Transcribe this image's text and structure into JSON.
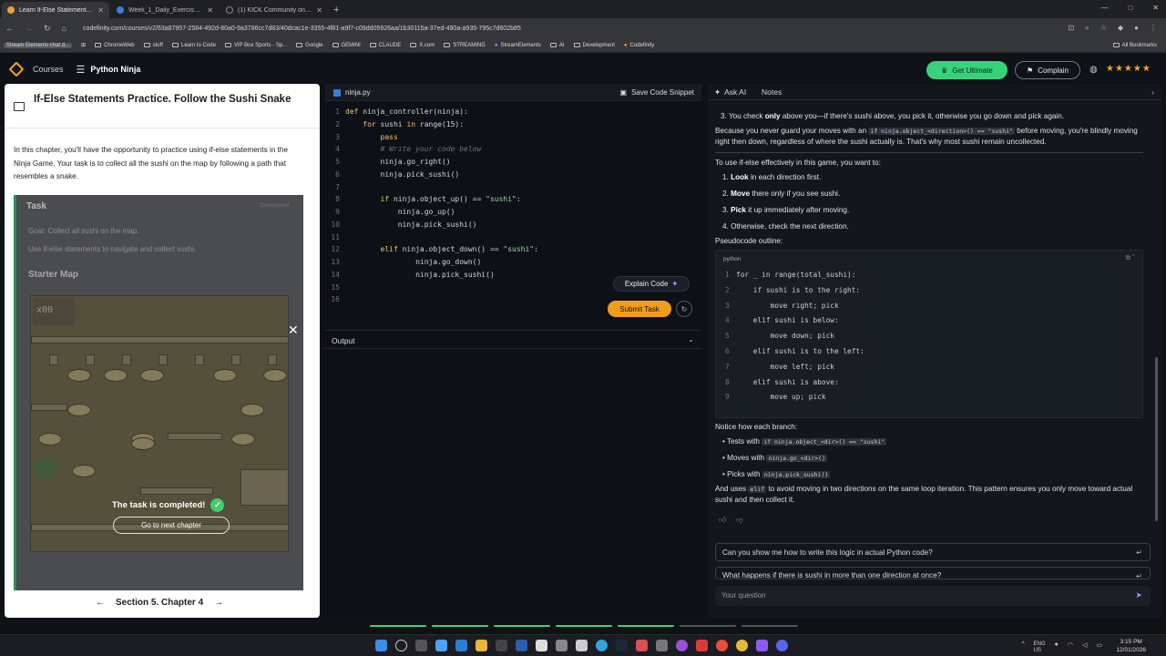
{
  "browser": {
    "tabs": [
      {
        "title": "Learn If-Else Statements Practic...",
        "active": true
      },
      {
        "title": "Week_1_Daily_Exercise_Guide.d",
        "active": false
      },
      {
        "title": "(1) KICK Community on X: \"@p",
        "active": false
      }
    ],
    "url": "codefinity.com/courses/v2/63a87957-2584-492d-80a0-9a3786cc7d83/40dcac1e-3355-4f81-a9f7-c09dd05926aa/1b30115a-37ed-490a-a935-795c7d602b85",
    "bookmarks": [
      "Stream Elements chat d...",
      "ChromeWeb",
      "stuff",
      "Learn to Code",
      "VIP Box Sports - Sp...",
      "Google",
      "GEMINI",
      "CLAUDE",
      "X.com",
      "STREAMING",
      "StreamElements",
      "AI",
      "Development",
      "Codefinity"
    ],
    "all_bookmarks": "All Bookmarks"
  },
  "header": {
    "courses": "Courses",
    "course_name": "Python Ninja",
    "get_ultimate": "Get Ultimate",
    "complain": "Complain",
    "stars": "★★★★★"
  },
  "lesson": {
    "title": "If-Else Statements Practice. Follow the Sushi Snake",
    "intro": "In this chapter, you'll have the opportunity to practice using if-else statements in the Ninja Game. Your task is to collect all the sushi on the map by following a path that resembles a snake.",
    "task_title": "Task",
    "completed_label": "Completed",
    "goal": "Goal: Collect all sushi on the map.",
    "goal_hint": "Use if-else statements to navigate and collect sushi.",
    "starter_map": "Starter Map",
    "score": "x00",
    "done_text": "The task is completed!",
    "next_button": "Go to next chapter",
    "section_nav": "Section 5. Chapter 4"
  },
  "editor": {
    "filename": "ninja.py",
    "save_snippet": "Save Code Snippet",
    "explain": "Explain Code",
    "submit": "Submit Task",
    "output": "Output",
    "lines": [
      "def ninja_controller(ninja):",
      "    for sushi in range(15):",
      "        pass",
      "        # Write your code below",
      "        ninja.go_right()",
      "        ninja.pick_sushi()",
      "",
      "        if ninja.object_up() == \"sushi\":",
      "            ninja.go_up()",
      "            ninja.pick_sushi()",
      "",
      "        elif ninja.object_down() == \"sushi\":",
      "                ninja.go_down()",
      "                ninja.pick_sushi()",
      "",
      ""
    ]
  },
  "assistant": {
    "tab_ask": "Ask AI",
    "tab_notes": "Notes",
    "p1_pre": "3. You check ",
    "p1_bold": "only",
    "p1_post": " above you—if there's sushi above, you pick it, otherwise you go down and pick again.",
    "p2_pre": "Because you never guard your moves with an ",
    "p2_code": "if ninja.object_<direction>() == \"sushi\"",
    "p2_post": " before moving, you're blindly moving right then down, regardless of where the sushi actually is. That's why most sushi remain uncollected.",
    "p3": "To use if-else effectively in this game, you want to:",
    "steps": [
      {
        "bold": "Look",
        "text": " in each direction first."
      },
      {
        "bold": "Move",
        "text": " there only if you see sushi."
      },
      {
        "bold": "Pick",
        "text": " it up immediately after moving."
      },
      {
        "bold": "",
        "text": "Otherwise, check the next direction."
      }
    ],
    "pseudo_label": "Pseudocode outline:",
    "code_lang": "python",
    "pseudo_lines": [
      "for _ in range(total_sushi):",
      "    if sushi is to the right:",
      "        move right; pick",
      "    elif sushi is below:",
      "        move down; pick",
      "    elif sushi is to the left:",
      "        move left; pick",
      "    elif sushi is above:",
      "        move up; pick"
    ],
    "notice": "Notice how each branch:",
    "bullets": [
      {
        "text": "Tests with ",
        "code": "if ninja.object_<dir>() == \"sushi\""
      },
      {
        "text": "Moves with ",
        "code": "ninja.go_<dir>()"
      },
      {
        "text": "Picks with ",
        "code": "ninja.pick_sushi()"
      }
    ],
    "closing_pre": "And uses ",
    "closing_code": "elif",
    "closing_post": " to avoid moving in two directions on the same loop iteration. This pattern ensures you only move toward actual sushi and then collect it.",
    "suggestions": [
      "Can you show me how to write this logic in actual Python code?",
      "What happens if there is sushi in more than one direction at once?"
    ],
    "question_placeholder": "Your question"
  },
  "taskbar": {
    "lang": "ENG\nUS",
    "time": "3:15 PM",
    "date": "12/01/2026"
  },
  "colors": {
    "accent_green": "#37d37c",
    "accent_orange": "#f29d1a",
    "stars": "#f5a623"
  }
}
